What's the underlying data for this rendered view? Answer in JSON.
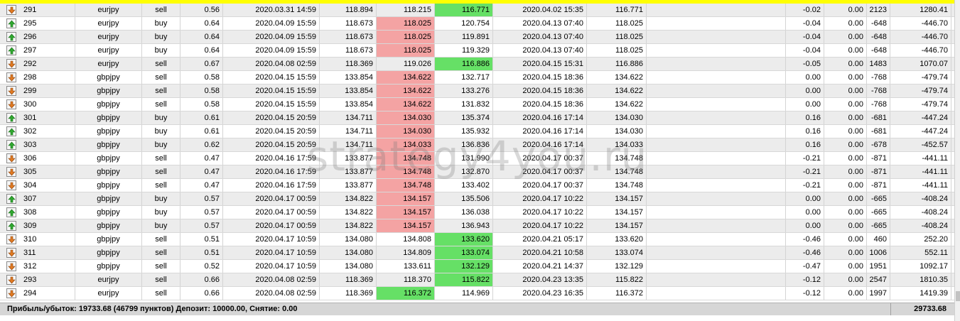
{
  "colors": {
    "header_strip": "#ffff00",
    "loss_cell": "#f4a3a3",
    "profit_cell": "#66e066",
    "footer_bg": "#d6d6d6"
  },
  "rows": [
    {
      "ticket": "291",
      "symbol": "eurjpy",
      "type": "sell",
      "lots": "0.56",
      "open_time": "2020.03.31 14:59",
      "open_price": "118.894",
      "sl": "118.215",
      "tp": "116.771",
      "close_time": "2020.04.02 15:35",
      "close_price": "116.771",
      "commission": "",
      "swap": "-0.02",
      "taxes": "0.00",
      "points": "2123",
      "profit": "1280.41",
      "sl_hl": "",
      "tp_hl": "green",
      "icon": "sell-order-icon"
    },
    {
      "ticket": "295",
      "symbol": "eurjpy",
      "type": "buy",
      "lots": "0.64",
      "open_time": "2020.04.09 15:59",
      "open_price": "118.673",
      "sl": "118.025",
      "tp": "120.754",
      "close_time": "2020.04.13 07:40",
      "close_price": "118.025",
      "commission": "",
      "swap": "-0.04",
      "taxes": "0.00",
      "points": "-648",
      "profit": "-446.70",
      "sl_hl": "red",
      "tp_hl": "",
      "icon": "buy-order-icon"
    },
    {
      "ticket": "296",
      "symbol": "eurjpy",
      "type": "buy",
      "lots": "0.64",
      "open_time": "2020.04.09 15:59",
      "open_price": "118.673",
      "sl": "118.025",
      "tp": "119.891",
      "close_time": "2020.04.13 07:40",
      "close_price": "118.025",
      "commission": "",
      "swap": "-0.04",
      "taxes": "0.00",
      "points": "-648",
      "profit": "-446.70",
      "sl_hl": "red",
      "tp_hl": "",
      "icon": "buy-order-icon"
    },
    {
      "ticket": "297",
      "symbol": "eurjpy",
      "type": "buy",
      "lots": "0.64",
      "open_time": "2020.04.09 15:59",
      "open_price": "118.673",
      "sl": "118.025",
      "tp": "119.329",
      "close_time": "2020.04.13 07:40",
      "close_price": "118.025",
      "commission": "",
      "swap": "-0.04",
      "taxes": "0.00",
      "points": "-648",
      "profit": "-446.70",
      "sl_hl": "red",
      "tp_hl": "",
      "icon": "buy-order-icon"
    },
    {
      "ticket": "292",
      "symbol": "eurjpy",
      "type": "sell",
      "lots": "0.67",
      "open_time": "2020.04.08 02:59",
      "open_price": "118.369",
      "sl": "119.026",
      "tp": "116.886",
      "close_time": "2020.04.15 15:31",
      "close_price": "116.886",
      "commission": "",
      "swap": "-0.05",
      "taxes": "0.00",
      "points": "1483",
      "profit": "1070.07",
      "sl_hl": "",
      "tp_hl": "green",
      "icon": "sell-order-icon"
    },
    {
      "ticket": "298",
      "symbol": "gbpjpy",
      "type": "sell",
      "lots": "0.58",
      "open_time": "2020.04.15 15:59",
      "open_price": "133.854",
      "sl": "134.622",
      "tp": "132.717",
      "close_time": "2020.04.15 18:36",
      "close_price": "134.622",
      "commission": "",
      "swap": "0.00",
      "taxes": "0.00",
      "points": "-768",
      "profit": "-479.74",
      "sl_hl": "red",
      "tp_hl": "",
      "icon": "sell-order-icon"
    },
    {
      "ticket": "299",
      "symbol": "gbpjpy",
      "type": "sell",
      "lots": "0.58",
      "open_time": "2020.04.15 15:59",
      "open_price": "133.854",
      "sl": "134.622",
      "tp": "133.276",
      "close_time": "2020.04.15 18:36",
      "close_price": "134.622",
      "commission": "",
      "swap": "0.00",
      "taxes": "0.00",
      "points": "-768",
      "profit": "-479.74",
      "sl_hl": "red",
      "tp_hl": "",
      "icon": "sell-order-icon"
    },
    {
      "ticket": "300",
      "symbol": "gbpjpy",
      "type": "sell",
      "lots": "0.58",
      "open_time": "2020.04.15 15:59",
      "open_price": "133.854",
      "sl": "134.622",
      "tp": "131.832",
      "close_time": "2020.04.15 18:36",
      "close_price": "134.622",
      "commission": "",
      "swap": "0.00",
      "taxes": "0.00",
      "points": "-768",
      "profit": "-479.74",
      "sl_hl": "red",
      "tp_hl": "",
      "icon": "sell-order-icon"
    },
    {
      "ticket": "301",
      "symbol": "gbpjpy",
      "type": "buy",
      "lots": "0.61",
      "open_time": "2020.04.15 20:59",
      "open_price": "134.711",
      "sl": "134.030",
      "tp": "135.374",
      "close_time": "2020.04.16 17:14",
      "close_price": "134.030",
      "commission": "",
      "swap": "0.16",
      "taxes": "0.00",
      "points": "-681",
      "profit": "-447.24",
      "sl_hl": "red",
      "tp_hl": "",
      "icon": "buy-order-icon"
    },
    {
      "ticket": "302",
      "symbol": "gbpjpy",
      "type": "buy",
      "lots": "0.61",
      "open_time": "2020.04.15 20:59",
      "open_price": "134.711",
      "sl": "134.030",
      "tp": "135.932",
      "close_time": "2020.04.16 17:14",
      "close_price": "134.030",
      "commission": "",
      "swap": "0.16",
      "taxes": "0.00",
      "points": "-681",
      "profit": "-447.24",
      "sl_hl": "red",
      "tp_hl": "",
      "icon": "buy-order-icon"
    },
    {
      "ticket": "303",
      "symbol": "gbpjpy",
      "type": "buy",
      "lots": "0.62",
      "open_time": "2020.04.15 20:59",
      "open_price": "134.711",
      "sl": "134.033",
      "tp": "136.836",
      "close_time": "2020.04.16 17:14",
      "close_price": "134.033",
      "commission": "",
      "swap": "0.16",
      "taxes": "0.00",
      "points": "-678",
      "profit": "-452.57",
      "sl_hl": "red",
      "tp_hl": "",
      "icon": "buy-order-icon"
    },
    {
      "ticket": "306",
      "symbol": "gbpjpy",
      "type": "sell",
      "lots": "0.47",
      "open_time": "2020.04.16 17:59",
      "open_price": "133.877",
      "sl": "134.748",
      "tp": "131.990",
      "close_time": "2020.04.17 00:37",
      "close_price": "134.748",
      "commission": "",
      "swap": "-0.21",
      "taxes": "0.00",
      "points": "-871",
      "profit": "-441.11",
      "sl_hl": "red",
      "tp_hl": "",
      "icon": "sell-order-icon"
    },
    {
      "ticket": "305",
      "symbol": "gbpjpy",
      "type": "sell",
      "lots": "0.47",
      "open_time": "2020.04.16 17:59",
      "open_price": "133.877",
      "sl": "134.748",
      "tp": "132.870",
      "close_time": "2020.04.17 00:37",
      "close_price": "134.748",
      "commission": "",
      "swap": "-0.21",
      "taxes": "0.00",
      "points": "-871",
      "profit": "-441.11",
      "sl_hl": "red",
      "tp_hl": "",
      "icon": "sell-order-icon"
    },
    {
      "ticket": "304",
      "symbol": "gbpjpy",
      "type": "sell",
      "lots": "0.47",
      "open_time": "2020.04.16 17:59",
      "open_price": "133.877",
      "sl": "134.748",
      "tp": "133.402",
      "close_time": "2020.04.17 00:37",
      "close_price": "134.748",
      "commission": "",
      "swap": "-0.21",
      "taxes": "0.00",
      "points": "-871",
      "profit": "-441.11",
      "sl_hl": "red",
      "tp_hl": "",
      "icon": "sell-order-icon"
    },
    {
      "ticket": "307",
      "symbol": "gbpjpy",
      "type": "buy",
      "lots": "0.57",
      "open_time": "2020.04.17 00:59",
      "open_price": "134.822",
      "sl": "134.157",
      "tp": "135.506",
      "close_time": "2020.04.17 10:22",
      "close_price": "134.157",
      "commission": "",
      "swap": "0.00",
      "taxes": "0.00",
      "points": "-665",
      "profit": "-408.24",
      "sl_hl": "red",
      "tp_hl": "",
      "icon": "buy-order-icon"
    },
    {
      "ticket": "308",
      "symbol": "gbpjpy",
      "type": "buy",
      "lots": "0.57",
      "open_time": "2020.04.17 00:59",
      "open_price": "134.822",
      "sl": "134.157",
      "tp": "136.038",
      "close_time": "2020.04.17 10:22",
      "close_price": "134.157",
      "commission": "",
      "swap": "0.00",
      "taxes": "0.00",
      "points": "-665",
      "profit": "-408.24",
      "sl_hl": "red",
      "tp_hl": "",
      "icon": "buy-order-icon"
    },
    {
      "ticket": "309",
      "symbol": "gbpjpy",
      "type": "buy",
      "lots": "0.57",
      "open_time": "2020.04.17 00:59",
      "open_price": "134.822",
      "sl": "134.157",
      "tp": "136.943",
      "close_time": "2020.04.17 10:22",
      "close_price": "134.157",
      "commission": "",
      "swap": "0.00",
      "taxes": "0.00",
      "points": "-665",
      "profit": "-408.24",
      "sl_hl": "red",
      "tp_hl": "",
      "icon": "buy-order-icon"
    },
    {
      "ticket": "310",
      "symbol": "gbpjpy",
      "type": "sell",
      "lots": "0.51",
      "open_time": "2020.04.17 10:59",
      "open_price": "134.080",
      "sl": "134.808",
      "tp": "133.620",
      "close_time": "2020.04.21 05:17",
      "close_price": "133.620",
      "commission": "",
      "swap": "-0.46",
      "taxes": "0.00",
      "points": "460",
      "profit": "252.20",
      "sl_hl": "",
      "tp_hl": "green",
      "icon": "sell-order-icon"
    },
    {
      "ticket": "311",
      "symbol": "gbpjpy",
      "type": "sell",
      "lots": "0.51",
      "open_time": "2020.04.17 10:59",
      "open_price": "134.080",
      "sl": "134.809",
      "tp": "133.074",
      "close_time": "2020.04.21 10:58",
      "close_price": "133.074",
      "commission": "",
      "swap": "-0.46",
      "taxes": "0.00",
      "points": "1006",
      "profit": "552.11",
      "sl_hl": "",
      "tp_hl": "green",
      "icon": "sell-order-icon"
    },
    {
      "ticket": "312",
      "symbol": "gbpjpy",
      "type": "sell",
      "lots": "0.52",
      "open_time": "2020.04.17 10:59",
      "open_price": "134.080",
      "sl": "133.611",
      "tp": "132.129",
      "close_time": "2020.04.21 14:37",
      "close_price": "132.129",
      "commission": "",
      "swap": "-0.47",
      "taxes": "0.00",
      "points": "1951",
      "profit": "1092.17",
      "sl_hl": "",
      "tp_hl": "green",
      "icon": "sell-order-icon"
    },
    {
      "ticket": "293",
      "symbol": "eurjpy",
      "type": "sell",
      "lots": "0.66",
      "open_time": "2020.04.08 02:59",
      "open_price": "118.369",
      "sl": "118.370",
      "tp": "115.822",
      "close_time": "2020.04.23 13:35",
      "close_price": "115.822",
      "commission": "",
      "swap": "-0.12",
      "taxes": "0.00",
      "points": "2547",
      "profit": "1810.35",
      "sl_hl": "",
      "tp_hl": "green",
      "icon": "sell-order-icon"
    },
    {
      "ticket": "294",
      "symbol": "eurjpy",
      "type": "sell",
      "lots": "0.66",
      "open_time": "2020.04.08 02:59",
      "open_price": "118.369",
      "sl": "116.372",
      "tp": "114.969",
      "close_time": "2020.04.23 16:35",
      "close_price": "116.372",
      "commission": "",
      "swap": "-0.12",
      "taxes": "0.00",
      "points": "1997",
      "profit": "1419.39",
      "sl_hl": "green",
      "tp_hl": "",
      "icon": "sell-order-icon"
    }
  ],
  "footer": {
    "summary": "Прибыль/убыток: 19733.68 (46799 пунктов) Депозит: 10000.00, Снятие: 0.00",
    "total": "29733.68"
  },
  "watermark": "strategy4you.ru"
}
